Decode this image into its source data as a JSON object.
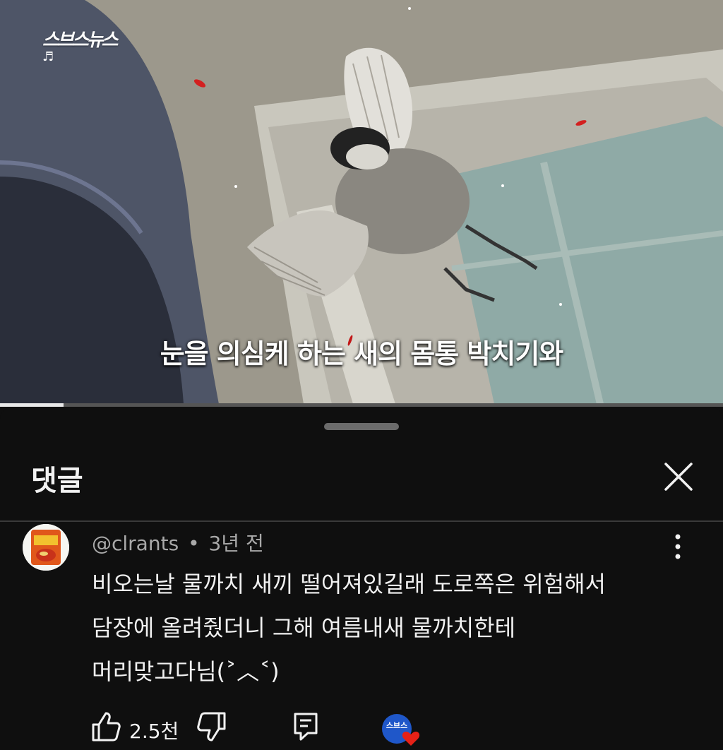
{
  "video": {
    "channel_logo": "스브스뉴스",
    "music_icon": "music-note-icon",
    "subtitle": "눈을 의심케 하는 새의 몸통 박치기와",
    "progress": 0.088
  },
  "comments_sheet": {
    "title": "댓글",
    "close_icon": "close-icon",
    "comment": {
      "author": "@clrants",
      "separator": "•",
      "time": "3년 전",
      "lines": [
        "비오는날 물까치 새끼 떨어져있길래 도로쪽은 위험해서",
        "담장에 올려줬더니 그해 여름내새 물까치한테",
        "머리맞고다님(˃︿˂)"
      ],
      "like_count": "2.5천",
      "creator_badge": "스브스"
    }
  },
  "colors": {
    "background": "#0f0f0f",
    "text_primary": "#f1f1f1",
    "text_secondary": "#a9a9a9",
    "heart": "#e62117",
    "badge_blue": "#1f57c9"
  }
}
